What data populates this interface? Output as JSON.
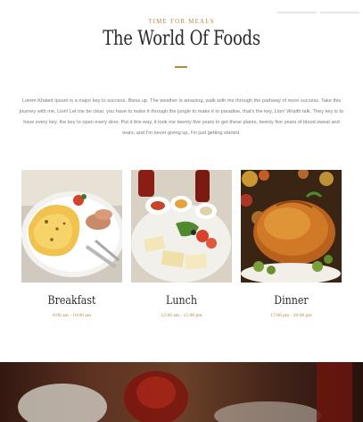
{
  "header": {
    "kicker": "TIME FOR MEALS",
    "title": "The World Of Foods"
  },
  "intro": {
    "text": "Lorem Khaled Ipsum is a major key to success. Bless up. The weather is amazing, walk with me through the pathway of more success. Take this journey with me, Lion! Let me be clear, you have to make it through the jungle to make it to paradise, that's the key, Lion! Wraith talk. They key is to have every key, the key to open every door. Put it this way, it took me twenty five years to get these plants, twenty five years of blood sweat and tears, and I'm never giving up, I'm just getting started."
  },
  "meals": [
    {
      "name": "Breakfast",
      "hours": "8:00 am - 10:00 am",
      "image": "breakfast-plate"
    },
    {
      "name": "Lunch",
      "hours": "12:00 am - 15:00 pm",
      "image": "lunch-platter"
    },
    {
      "name": "Dinner",
      "hours": "17:00 pm - 20:00 pm",
      "image": "roast-chicken"
    }
  ],
  "colors": {
    "accent": "#b5894a",
    "title": "#2b2b2b",
    "body_text": "#7a7a7a"
  }
}
